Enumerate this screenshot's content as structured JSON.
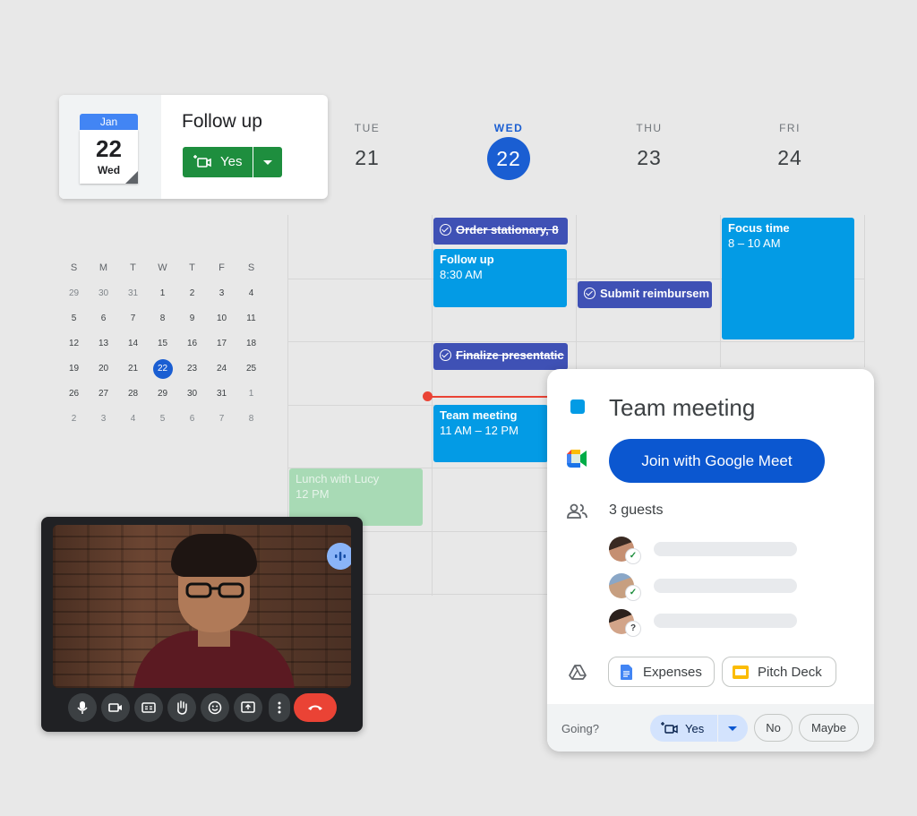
{
  "followup": {
    "cal_month": "Jan",
    "cal_day": "22",
    "cal_weekday": "Wed",
    "title": "Follow up",
    "yes_label": "Yes"
  },
  "days": [
    {
      "name": "TUE",
      "num": "21"
    },
    {
      "name": "WED",
      "num": "22"
    },
    {
      "name": "THU",
      "num": "23"
    },
    {
      "name": "FRI",
      "num": "24"
    }
  ],
  "mini_calendar": {
    "headers": [
      "S",
      "M",
      "T",
      "W",
      "T",
      "F",
      "S"
    ],
    "weeks": [
      [
        "29",
        "30",
        "31",
        "1",
        "2",
        "3",
        "4"
      ],
      [
        "5",
        "6",
        "7",
        "8",
        "9",
        "10",
        "11"
      ],
      [
        "12",
        "13",
        "14",
        "15",
        "16",
        "17",
        "18"
      ],
      [
        "19",
        "20",
        "21",
        "22",
        "23",
        "24",
        "25"
      ],
      [
        "26",
        "27",
        "28",
        "29",
        "30",
        "31",
        "1"
      ],
      [
        "2",
        "3",
        "4",
        "5",
        "6",
        "7",
        "8"
      ]
    ],
    "selected": "22"
  },
  "events": {
    "order_stationary": "Order stationary, 8",
    "followup_title": "Follow up",
    "followup_time": "8:30 AM",
    "submit_reimbursement": "Submit reimbursem",
    "focus_title": "Focus time",
    "focus_time": "8 – 10 AM",
    "finalize": "Finalize presentatic",
    "team_title": "Team meeting",
    "team_time": "11 AM – 12 PM",
    "lunch_title": "Lunch with Lucy",
    "lunch_time": "12 PM"
  },
  "detail": {
    "title": "Team meeting",
    "join_label": "Join with Google Meet",
    "guests_label": "3 guests",
    "guest_status": [
      "✓",
      "✓",
      "?"
    ],
    "attachments": [
      "Expenses",
      "Pitch Deck"
    ],
    "going_label": "Going?",
    "rsvp_yes": "Yes",
    "rsvp_no": "No",
    "rsvp_maybe": "Maybe"
  },
  "colors": {
    "event_blue": "#039be5",
    "task_indigo": "#3f51b5",
    "today_blue": "#1a5ed2",
    "meet_button": "#0b57d0",
    "end_call": "#ea4335"
  },
  "icons": {
    "video_call_controls": [
      "mic-icon",
      "camera-icon",
      "captions-icon",
      "raise-hand-icon",
      "emoji-icon",
      "present-icon",
      "more-icon",
      "end-call-icon"
    ]
  }
}
